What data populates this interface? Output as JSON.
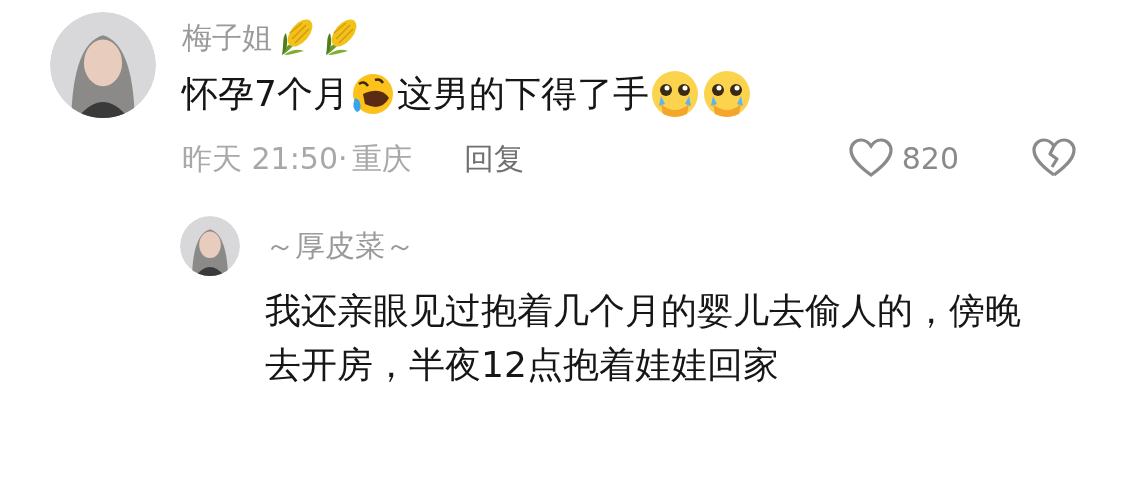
{
  "comment": {
    "author": "梅子姐",
    "author_badges": [
      {
        "kind": "corn"
      },
      {
        "kind": "corn"
      }
    ],
    "content": [
      {
        "kind": "text",
        "text": "怀孕7个月"
      },
      {
        "kind": "laugh-cry"
      },
      {
        "kind": "text",
        "text": "这男的下得了手"
      },
      {
        "kind": "pleading"
      },
      {
        "kind": "pleading"
      }
    ],
    "time": "昨天 21:50·",
    "location": "重庆",
    "reply_label": "回复",
    "likes": "820",
    "liked": false,
    "replies": [
      {
        "author": "～厚皮菜～",
        "content": "我还亲眼见过抱着几个月的婴儿去偷人的，傍晚去开房，半夜12点抱着娃娃回家"
      }
    ]
  }
}
